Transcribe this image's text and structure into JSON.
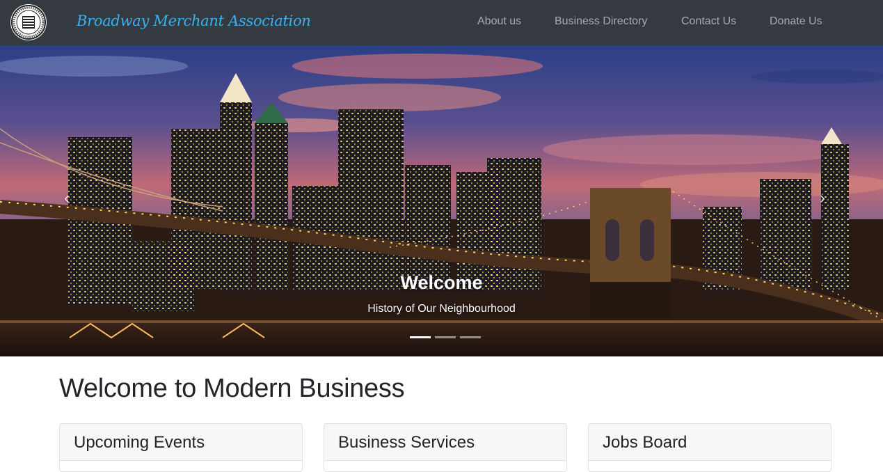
{
  "navbar": {
    "brand": "Broadway Merchant Association",
    "logo_icon": "association-seal-icon",
    "links": [
      {
        "label": "About us"
      },
      {
        "label": "Business Directory"
      },
      {
        "label": "Contact Us"
      },
      {
        "label": "Donate Us"
      }
    ],
    "background": "#343a40",
    "brand_color": "#3ab0f0",
    "link_color": "#a7abaf"
  },
  "carousel": {
    "slide_image": "brooklyn-bridge-night-skyline",
    "caption_title": "Welcome",
    "caption_subtitle": "History of Our Neighbourhood",
    "indicators": 3,
    "active_indicator": 0,
    "prev_icon": "chevron-left-icon",
    "next_icon": "chevron-right-icon"
  },
  "main": {
    "heading": "Welcome to Modern Business",
    "cards": [
      {
        "title": "Upcoming Events"
      },
      {
        "title": "Business Services"
      },
      {
        "title": "Jobs Board"
      }
    ]
  }
}
